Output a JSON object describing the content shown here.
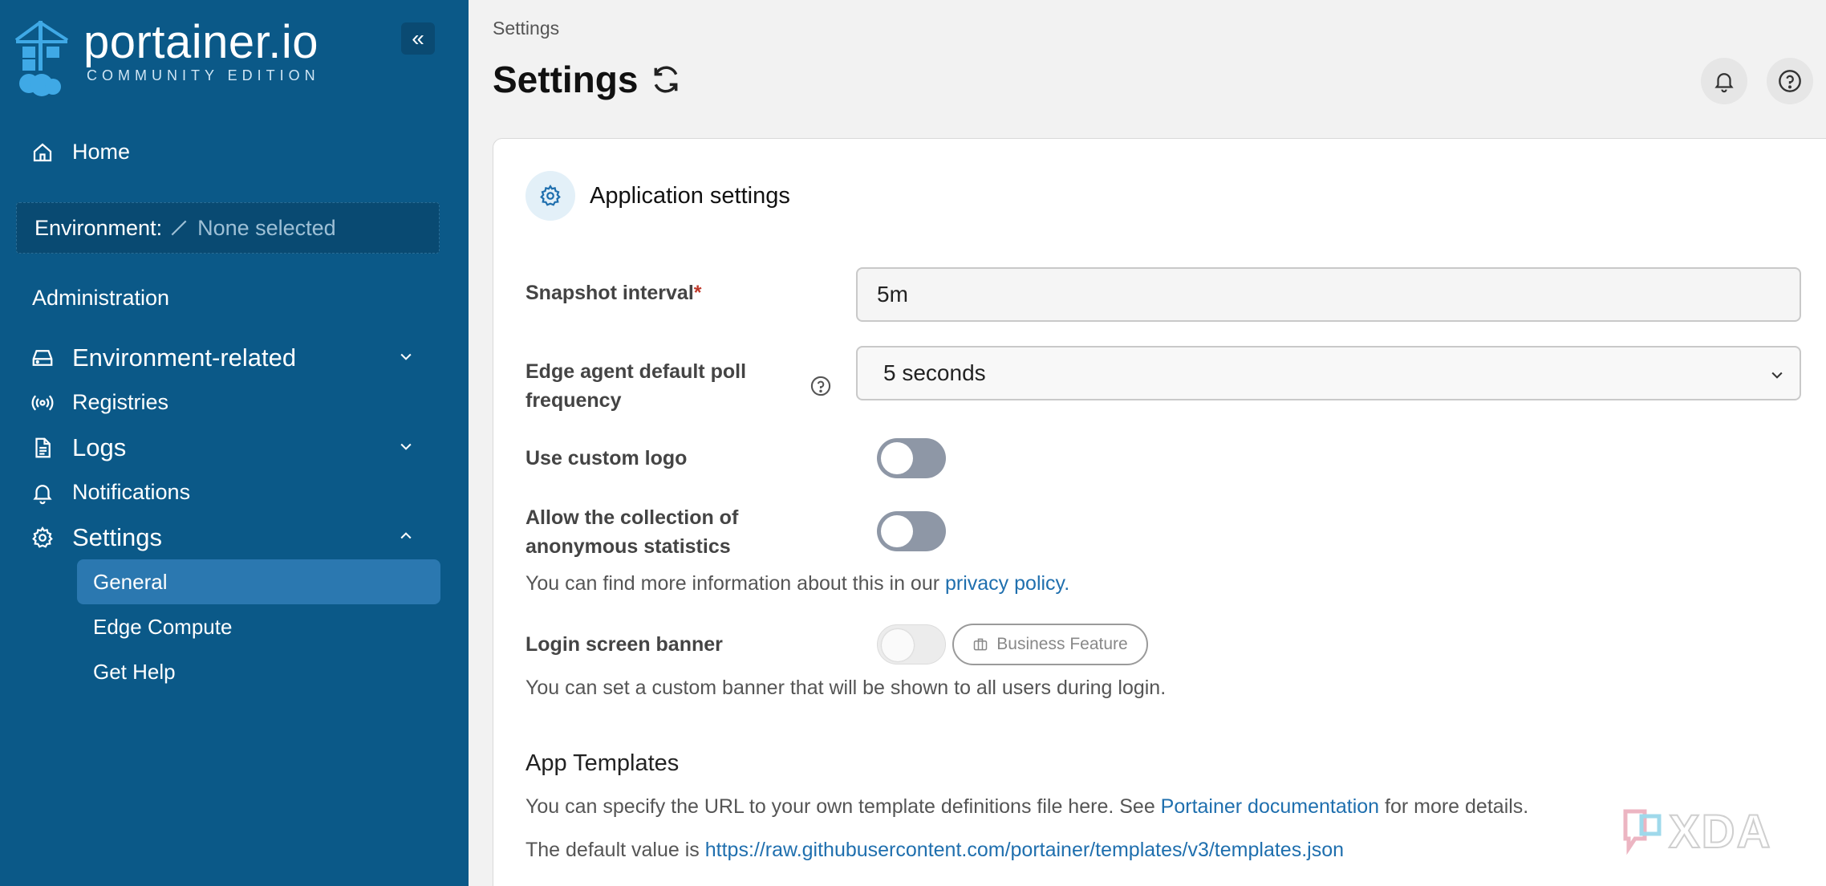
{
  "brand": {
    "name": "portainer.io",
    "edition": "COMMUNITY EDITION"
  },
  "sidebar": {
    "home_label": "Home",
    "environment_label": "Environment:",
    "environment_value": "None selected",
    "administration_heading": "Administration",
    "items": [
      {
        "label": "Environment-related"
      },
      {
        "label": "Registries"
      },
      {
        "label": "Logs"
      },
      {
        "label": "Notifications"
      },
      {
        "label": "Settings"
      }
    ],
    "settings_sub": [
      {
        "label": "General",
        "active": true
      },
      {
        "label": "Edge Compute"
      },
      {
        "label": "Get Help"
      }
    ]
  },
  "header": {
    "breadcrumb": "Settings",
    "title": "Settings"
  },
  "app_settings": {
    "title": "Application settings",
    "snapshot_label": "Snapshot interval",
    "snapshot_required": "*",
    "snapshot_value": "5m",
    "poll_label_line1": "Edge agent default poll",
    "poll_label_line2": "frequency",
    "poll_value": "5 seconds",
    "custom_logo_label": "Use custom logo",
    "custom_logo_on": false,
    "stats_label_line1": "Allow the collection of",
    "stats_label_line2": "anonymous statistics",
    "stats_on": false,
    "privacy_text": "You can find more information about this in our ",
    "privacy_link": "privacy policy.",
    "banner_label": "Login screen banner",
    "banner_on": false,
    "business_badge": "Business Feature",
    "banner_help": "You can set a custom banner that will be shown to all users during login."
  },
  "app_templates": {
    "title": "App Templates",
    "desc_text": "You can specify the URL to your own template definitions file here. See ",
    "desc_link": "Portainer documentation",
    "desc_tail": " for more details.",
    "default_text": "The default value is ",
    "default_link": "https://raw.githubusercontent.com/portainer/templates/v3/templates.json"
  },
  "watermark": {
    "text": "XDA"
  },
  "colors": {
    "sidebar": "#0b5988",
    "active_item": "#2b78b0",
    "link": "#1f6fae"
  }
}
